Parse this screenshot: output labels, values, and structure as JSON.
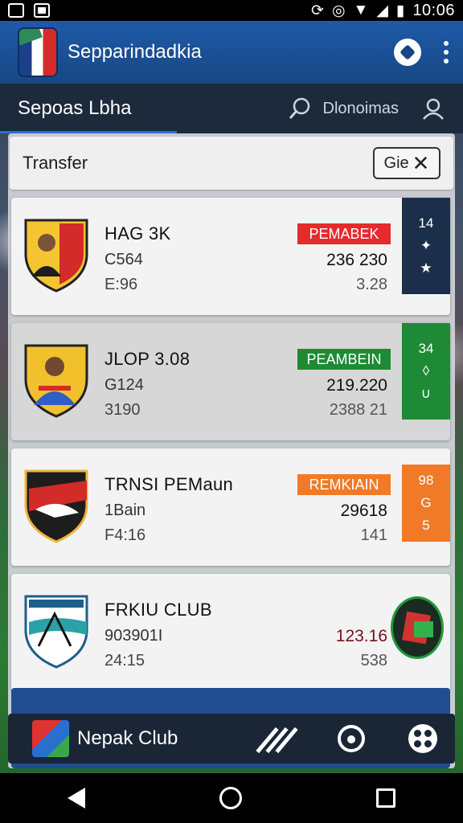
{
  "status_bar": {
    "time": "10:06"
  },
  "app_bar": {
    "title": "Sepparindadkia"
  },
  "sub_bar": {
    "title": "Sepoas Lbha",
    "label": "Dlonoimas"
  },
  "transfer": {
    "title": "Transfer",
    "button_label": "Gie"
  },
  "cards": [
    {
      "name": "HAG  3K",
      "code": "C564",
      "date": "E:96",
      "badge": "PEMABEK",
      "price": "236 230",
      "sub": "3.28",
      "side_top": "14",
      "badge_color": "#e52b2b",
      "side_color": "#1c2f4a"
    },
    {
      "name": "JLOP  3.08",
      "code": "G124",
      "date": "3190",
      "badge": "PEAMBEIN",
      "price": "219.220",
      "sub": "2388 21",
      "side_top": "34",
      "badge_color": "#1f8a36",
      "side_color": "#1f8a36"
    },
    {
      "name": "TRNSI PEMaun",
      "code": "1Bain",
      "date": "F4:16",
      "badge": "REMKIAIN",
      "price": "29618",
      "sub": "141",
      "side_top": "98",
      "badge_color": "#f07a28",
      "side_color": "#f07a28"
    },
    {
      "name": "FRKIU CLUB",
      "code": "903901I",
      "date": "24:15",
      "badge": "",
      "price": "123.16",
      "sub": "538",
      "side_top": "",
      "badge_color": "",
      "side_color": ""
    }
  ],
  "bottom_nav": {
    "club": "Nepak Club"
  }
}
